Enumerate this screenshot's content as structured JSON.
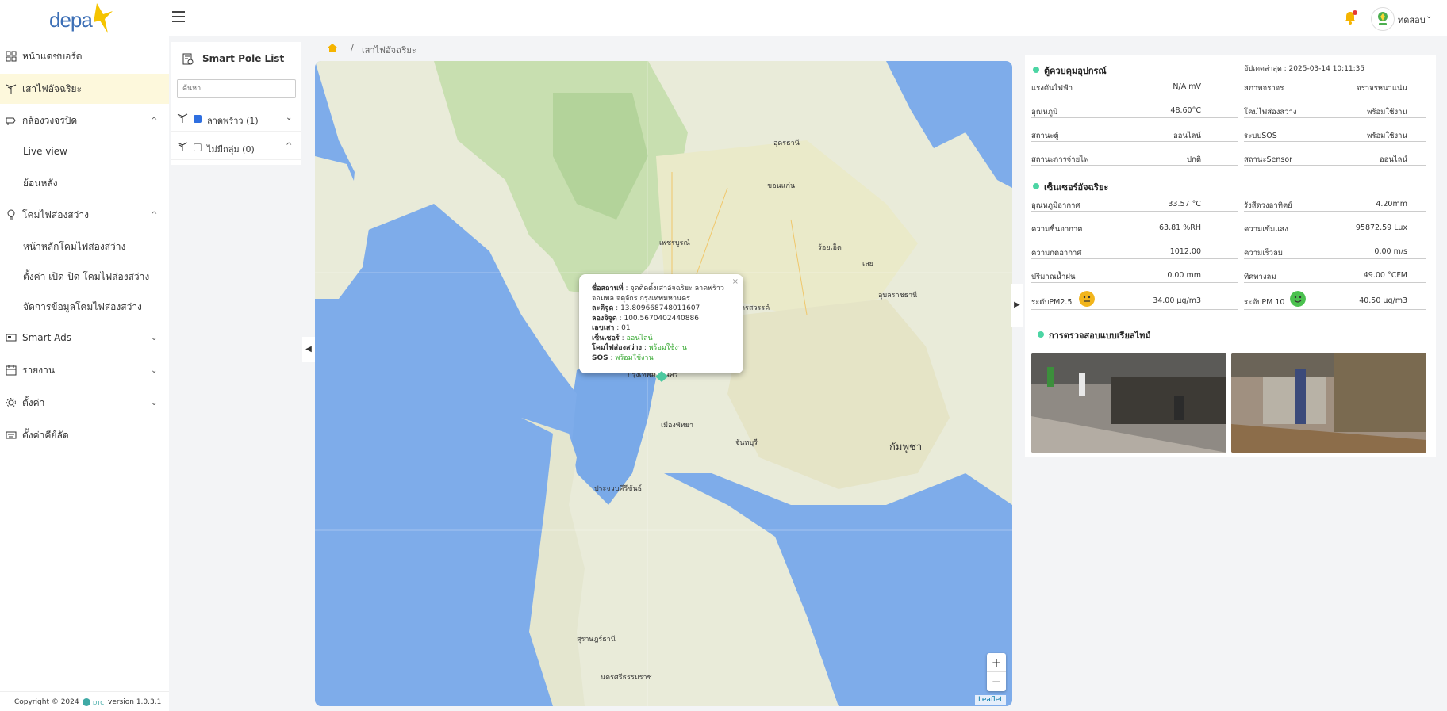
{
  "brand": {
    "logo_text": "depa"
  },
  "header": {
    "username": "ทดสอบ"
  },
  "sidebar": {
    "dashboard": "หน้าแดชบอร์ด",
    "smart_pole": "เสาไฟอัจฉริยะ",
    "cctv": "กล้องวงจรปิด",
    "live_view": "Live view",
    "playback": "ย้อนหลัง",
    "lamp": "โคมไฟส่องสว่าง",
    "lamp_main": "หน้าหลักโคมไฟส่องสว่าง",
    "lamp_schedule": "ตั้งค่า เปิด-ปิด โคมไฟส่องสว่าง",
    "lamp_manage": "จัดการข้อมูลโคมไฟส่องสว่าง",
    "smart_ads": "Smart Ads",
    "report": "รายงาน",
    "settings": "ตั้งค่า",
    "shortcuts": "ตั้งค่าคีย์ลัด"
  },
  "footer": {
    "copyright": "Copyright © 2024",
    "version": "version 1.0.3.1",
    "brand_small": "DTC"
  },
  "pole_list": {
    "title": "Smart Pole List",
    "search_placeholder": "ค้นหา",
    "groups": [
      {
        "label": "ลาดพร้าว (1)",
        "checked": true
      },
      {
        "label": "ไม่มีกลุ่ม (0)",
        "checked": false
      }
    ]
  },
  "breadcrumb": {
    "current": "เสาไฟอัจฉริยะ"
  },
  "map": {
    "labels": {
      "cambodia": "กัมพูชา",
      "pattaya": "เมืองพัทยา",
      "udon": "อุดรธานี",
      "ubon": "อุบลราชธานี",
      "nakhon_sawan": "นครสวรรค์",
      "phetchabun": "เพชรบูรณ์",
      "prachuap": "ประจวบคีรีขันธ์",
      "surat": "สุราษฎร์ธานี",
      "nakhon_si": "นครศรีธรรมราช",
      "chanthaburi": "จันทบุรี",
      "khonkaen": "ขอนแก่น",
      "roiet": "ร้อยเอ็ด",
      "loei": "เลย",
      "bangkok": "กรุงเทพมหานคร"
    },
    "zoom_in": "+",
    "zoom_out": "−",
    "attribution": "Leaflet"
  },
  "popup": {
    "close": "×",
    "station_label": "ชื่อสถานที่",
    "station_value": "จุดติดตั้งเสาอัจฉริยะ ลาดพร้าว",
    "station_value2": "จอมพล จตุจักร กรุงเทพมหานคร",
    "lat_label": "ละติจูด",
    "lat_value": "13.809668748011607",
    "lng_label": "ลองจิจูด",
    "lng_value": "100.5670402440886",
    "num_label": "เลขเสา",
    "num_value": "01",
    "sensor_label": "เซ็นเซอร์",
    "sensor_value": "ออนไลน์",
    "lamp_label": "โคมไฟส่องสว่าง",
    "lamp_value": "พร้อมใช้งาน",
    "sos_label": "SOS",
    "sos_value": "พร้อมใช้งาน"
  },
  "device_panel": {
    "title": "ตู้ควบคุมอุปกรณ์",
    "updated": "อัปเดตล่าสุด : 2025-03-14 10:11:35",
    "left": [
      {
        "k": "แรงดันไฟฟ้า",
        "v": "N/A mV"
      },
      {
        "k": "อุณหภูมิ",
        "v": "48.60°C"
      },
      {
        "k": "สถานะตู้",
        "v": "ออนไลน์"
      },
      {
        "k": "สถานะการจ่ายไฟ",
        "v": "ปกติ"
      }
    ],
    "right": [
      {
        "k": "สภาพจราจร",
        "v": "จราจรหนาแน่น"
      },
      {
        "k": "โคมไฟส่องสว่าง",
        "v": "พร้อมใช้งาน"
      },
      {
        "k": "ระบบSOS",
        "v": "พร้อมใช้งาน"
      },
      {
        "k": "สถานะSensor",
        "v": "ออนไลน์"
      }
    ]
  },
  "sensor_panel": {
    "title": "เซ็นเซอร์อัจฉริยะ",
    "left": [
      {
        "k": "อุณหภูมิอากาศ",
        "v": "33.57 °C"
      },
      {
        "k": "ความชื้นอากาศ",
        "v": "63.81 %RH"
      },
      {
        "k": "ความกดอากาศ",
        "v": "1012.00"
      },
      {
        "k": "ปริมาณน้ำฝน",
        "v": "0.00 mm"
      },
      {
        "k": "ระดับPM2.5",
        "v": "34.00 µg/m3"
      }
    ],
    "right": [
      {
        "k": "รังสีดวงอาทิตย์",
        "v": "4.20mm"
      },
      {
        "k": "ความเข้มแสง",
        "v": "95872.59 Lux"
      },
      {
        "k": "ความเร็วลม",
        "v": "0.00 m/s"
      },
      {
        "k": "ทิศทางลม",
        "v": "49.00 °CFM"
      },
      {
        "k": "ระดับPM 10",
        "v": "40.50 µg/m3"
      }
    ],
    "pm25_color": "#f2b51c",
    "pm10_color": "#4bc14f"
  },
  "realtime": {
    "title": "การตรวจสอบแบบเรียลไทม์"
  },
  "colors": {
    "accent": "#f5c400",
    "active_bg": "#fdf8dc",
    "status_green": "#3aaa35",
    "section_dot": "#4cd5a4",
    "map_sea": "#7eacea"
  }
}
